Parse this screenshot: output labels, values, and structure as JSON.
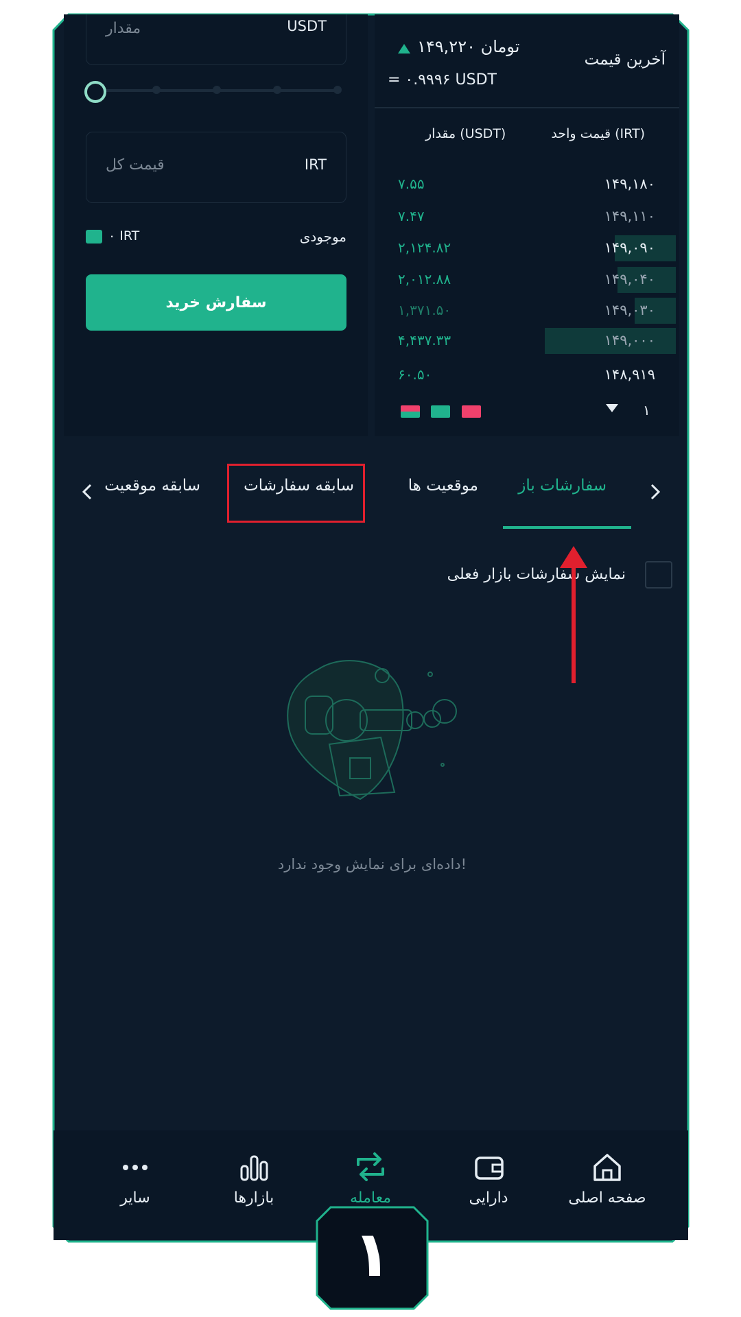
{
  "buy_form": {
    "amount_placeholder": "مقدار",
    "amount_unit": "USDT",
    "total_placeholder": "قیمت کل",
    "total_unit": "IRT",
    "balance_label": "موجودی",
    "balance_value": "۰ IRT",
    "slider_value": 0,
    "buy_button_label": "سفارش خرید"
  },
  "ticker": {
    "last_price_label": "آخرین قیمت",
    "last_price_toman": "۱۴۹,۲۲۰ تومان",
    "last_price_usdt": "= ۰.۹۹۹۶ USDT"
  },
  "orderbook": {
    "col_price": "قیمت واحد (IRT)",
    "col_amount": "مقدار (USDT)",
    "rows": [
      {
        "price": "۱۴۹,۱۸۰",
        "amount": "۷.۵۵",
        "depth": 0
      },
      {
        "price": "۱۴۹,۱۱۰",
        "amount": "۷.۴۷",
        "depth": 0
      },
      {
        "price": "۱۴۹,۰۹۰",
        "amount": "۲,۱۲۴.۸۲",
        "depth": 0.21
      },
      {
        "price": "۱۴۹,۰۴۰",
        "amount": "۲,۰۱۲.۸۸",
        "depth": 0.2
      },
      {
        "price": "۱۴۹,۰۳۰",
        "amount": "۱,۳۷۱.۵۰",
        "depth": 0.14
      },
      {
        "price": "۱۴۹,۰۰۰",
        "amount": "۴,۴۳۷.۳۳",
        "depth": 0.45
      },
      {
        "price": "۱۴۸,۹۱۹",
        "amount": "۶۰.۵۰",
        "depth": 0
      }
    ],
    "precision_value": "۱",
    "colors": {
      "sell": "#f0416c",
      "buy": "#20b38d"
    }
  },
  "tabs": [
    {
      "label": "سفارشات باز",
      "active": true
    },
    {
      "label": "موقعیت ها",
      "active": false
    },
    {
      "label": "سابقه سفارشات",
      "active": false
    },
    {
      "label": "سابقه موقعیت",
      "active": false
    }
  ],
  "filter_checkbox_label": "نمایش سفارشات بازار فعلی",
  "empty_state_text": "داده‌ای برای نمایش وجود ندارد!",
  "bottom_nav": [
    {
      "label": "صفحه اصلی",
      "icon": "home-icon"
    },
    {
      "label": "دارایی",
      "icon": "wallet-icon"
    },
    {
      "label": "معامله",
      "icon": "swap-icon",
      "active": true
    },
    {
      "label": "بازارها",
      "icon": "bar-chart-icon"
    },
    {
      "label": "سایر",
      "icon": "more-icon"
    }
  ],
  "step_badge": "۱",
  "colors": {
    "accent": "#20b38d",
    "background": "#0d1b2b",
    "annotation": "#e0202e"
  }
}
